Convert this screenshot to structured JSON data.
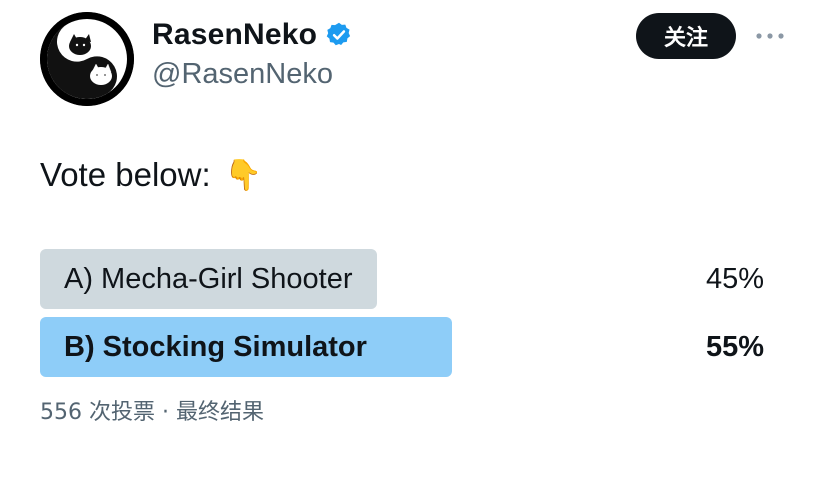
{
  "author": {
    "display_name": "RasenNeko",
    "handle": "@RasenNeko",
    "verified": true,
    "avatar_icon": "yin-yang-cats-avatar"
  },
  "actions": {
    "follow_label": "关注",
    "more_icon": "more-horizontal-icon"
  },
  "tweet": {
    "text": "Vote below:",
    "emoji": "👇"
  },
  "poll": {
    "options": [
      {
        "label": "A) Mecha-Girl Shooter",
        "percent_label": "45%",
        "share": 0.45,
        "winner": false
      },
      {
        "label": "B) Stocking Simulator",
        "percent_label": "55%",
        "share": 0.55,
        "winner": true
      }
    ],
    "footer": "556 次投票 · 最终结果"
  },
  "colors": {
    "bar_default": "#cfd9de",
    "bar_winner": "#8ecdf8",
    "verified_blue": "#1d9bf0",
    "follow_bg": "#0f1419"
  }
}
